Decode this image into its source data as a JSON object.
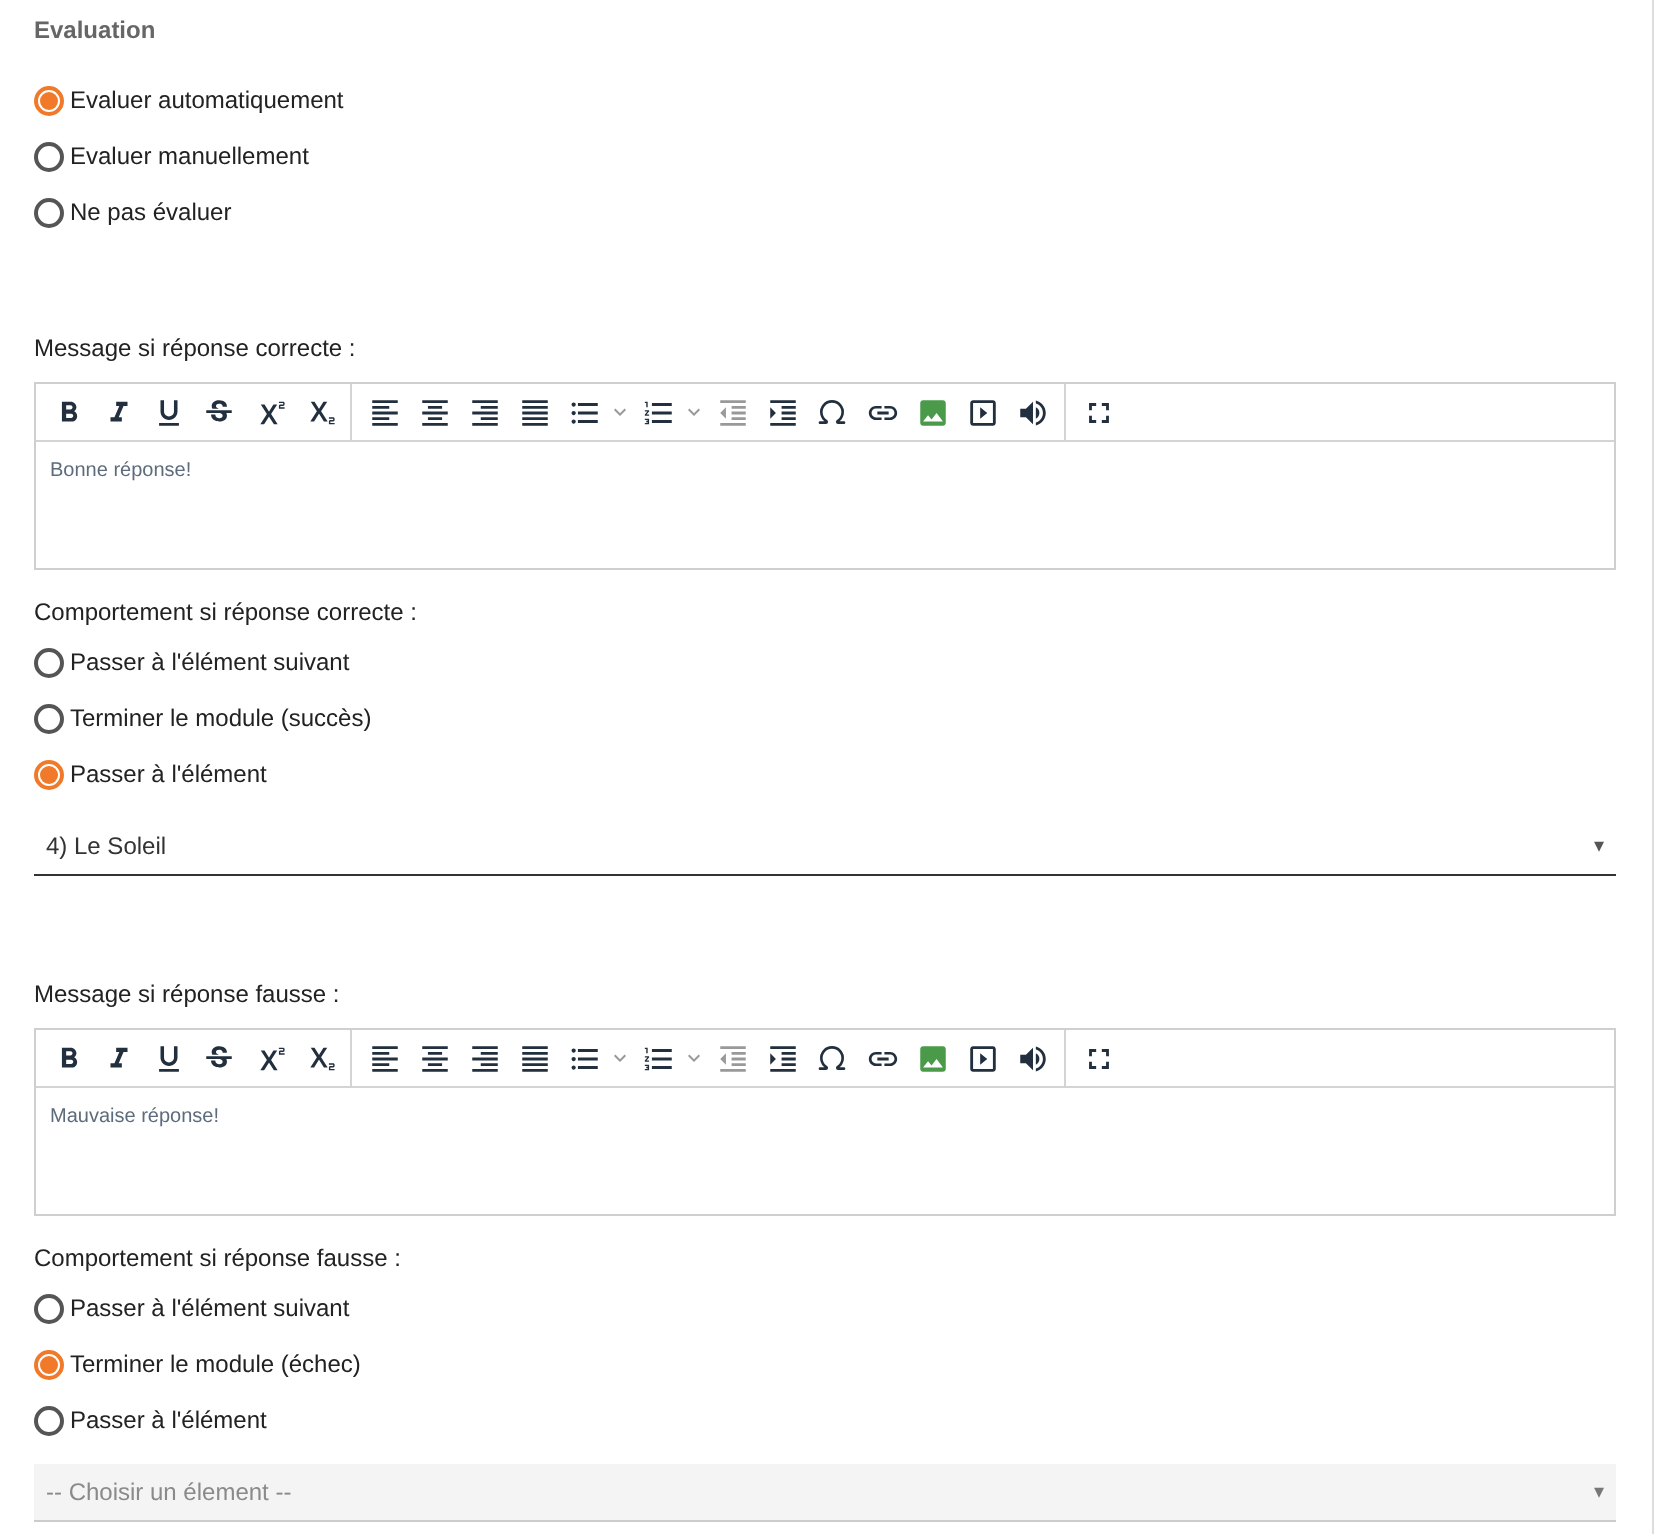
{
  "section_title": "Evaluation",
  "evaluation_options": [
    {
      "label": "Evaluer automatiquement",
      "selected": true
    },
    {
      "label": "Evaluer manuellement",
      "selected": false
    },
    {
      "label": "Ne pas évaluer",
      "selected": false
    }
  ],
  "blocks": [
    {
      "message_label": "Message si réponse correcte :",
      "editor_text": "Bonne réponse!",
      "behavior_label": "Comportement si réponse correcte :",
      "behavior_options": [
        {
          "label": "Passer à l'élément suivant",
          "selected": false
        },
        {
          "label": "Terminer le module (succès)",
          "selected": false
        },
        {
          "label": "Passer à l'élément",
          "selected": true
        }
      ],
      "select": {
        "value": "4) Le Soleil",
        "arrow": "▾",
        "disabled": false
      }
    },
    {
      "message_label": "Message si réponse fausse :",
      "editor_text": "Mauvaise réponse!",
      "behavior_label": "Comportement si réponse fausse :",
      "behavior_options": [
        {
          "label": "Passer à l'élément suivant",
          "selected": false
        },
        {
          "label": "Terminer le module (échec)",
          "selected": true
        },
        {
          "label": "Passer à l'élément",
          "selected": false
        }
      ],
      "select": {
        "placeholder": "-- Choisir un élement --",
        "arrow": "▾",
        "disabled": true
      }
    }
  ]
}
